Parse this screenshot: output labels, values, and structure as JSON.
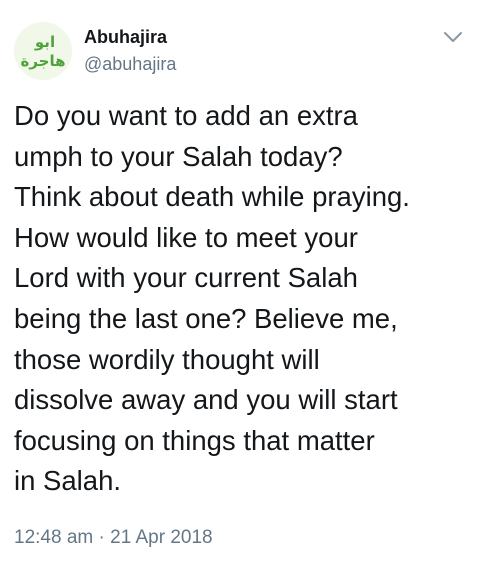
{
  "tweet": {
    "author": {
      "display_name": "Abuhajira",
      "handle": "@abuhajira",
      "avatar_text_top": "ابو",
      "avatar_text_bottom": "هاجرة",
      "avatar_color": "#4ea43a",
      "avatar_bg": "#f1f7e9"
    },
    "menu_icon": "chevron-down-icon",
    "text_lines": [
      "Do you want to add an extra",
      "umph to your Salah today?",
      "Think about death while praying.",
      "How would like to meet your",
      "Lord with your current Salah",
      "being the last one? Believe me,",
      "those wordily thought will",
      "dissolve away and you will start",
      "focusing on things that matter",
      "in Salah."
    ],
    "time": "12:48 am",
    "separator": "·",
    "date": "21 Apr 2018"
  },
  "colors": {
    "text": "#14171a",
    "secondary": "#657786",
    "caret": "#8899a6"
  }
}
